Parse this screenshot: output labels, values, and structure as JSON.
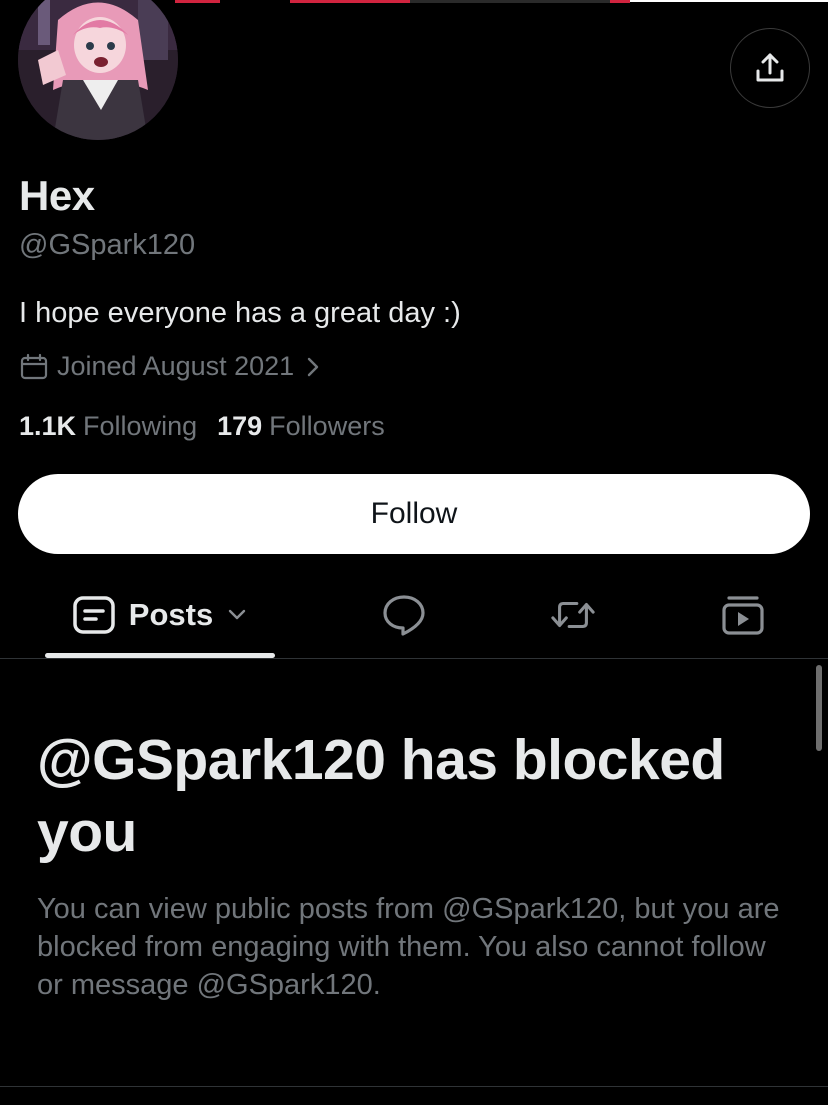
{
  "profile": {
    "display_name": "Hex",
    "handle": "@GSpark120",
    "bio": "I hope everyone has a great day :)",
    "joined": "Joined August 2021",
    "following_count": "1.1K",
    "following_label": "Following",
    "followers_count": "179",
    "followers_label": "Followers"
  },
  "actions": {
    "follow_label": "Follow",
    "share_icon": "share-icon"
  },
  "tabs": [
    {
      "label": "Posts",
      "icon": "posts-icon",
      "active": true
    },
    {
      "label": "",
      "icon": "reply-bubble-icon"
    },
    {
      "label": "",
      "icon": "repost-icon"
    },
    {
      "label": "",
      "icon": "media-icon"
    }
  ],
  "blocked": {
    "title": "@GSpark120 has blocked you",
    "description": "You can view public posts from @GSpark120, but you are blocked from engaging with them. You also cannot follow or message @GSpark120."
  },
  "colors": {
    "background": "#000000",
    "primary_text": "#e7e9ea",
    "secondary_text": "#71767b",
    "follow_button_bg": "#ffffff",
    "avatar_hair": "#e89ab8"
  }
}
